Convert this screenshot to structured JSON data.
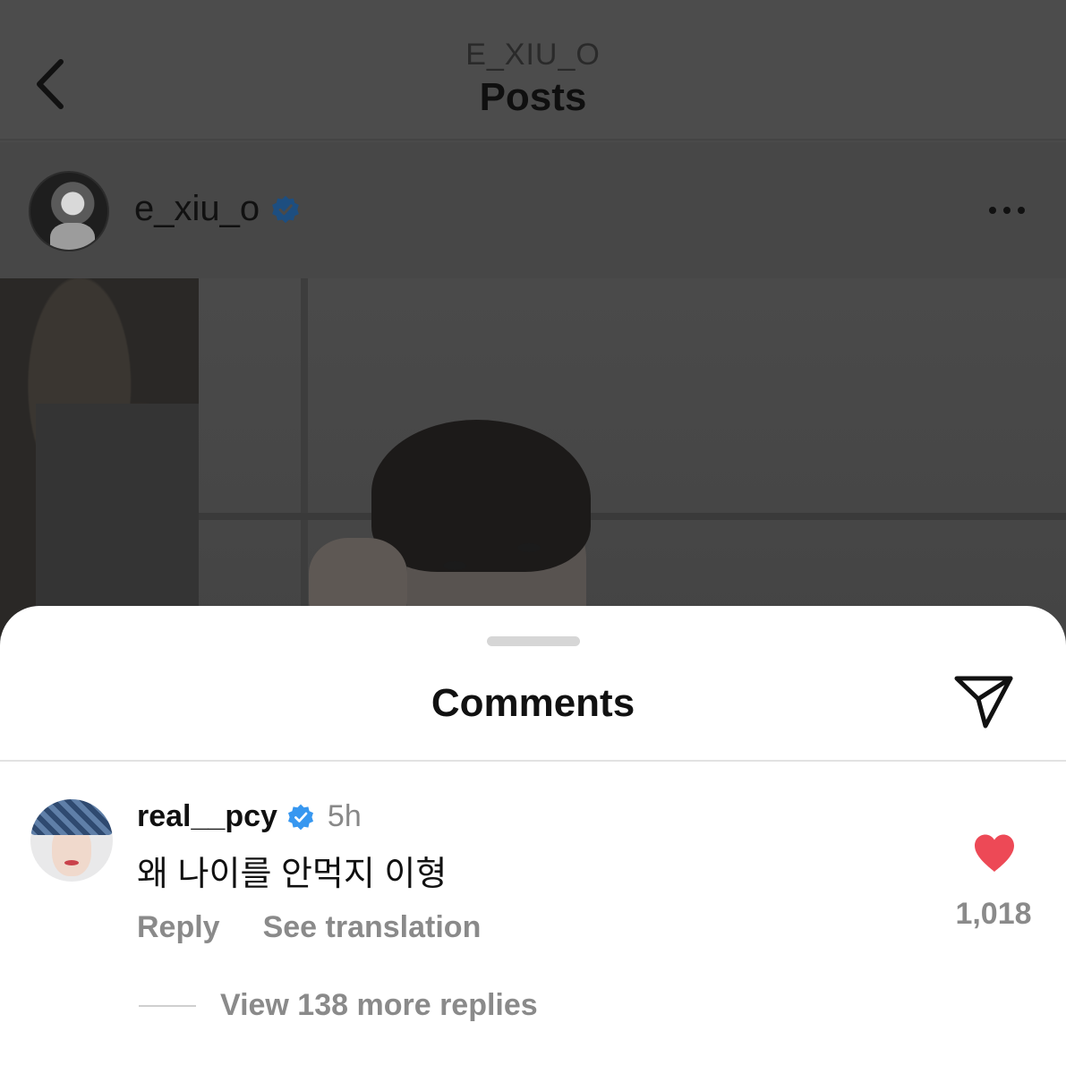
{
  "header": {
    "username": "E_XIU_O",
    "title": "Posts"
  },
  "post": {
    "username": "e_xiu_o",
    "verified": true
  },
  "comments_sheet": {
    "title": "Comments",
    "comment": {
      "username": "real__pcy",
      "verified": true,
      "time": "5h",
      "text": "왜 나이를 안먹지 이형",
      "reply_label": "Reply",
      "translate_label": "See translation",
      "likes": "1,018",
      "replies_label": "View 138 more replies"
    }
  },
  "colors": {
    "verified_badge": "#3797f0",
    "like_heart": "#ed4956"
  }
}
